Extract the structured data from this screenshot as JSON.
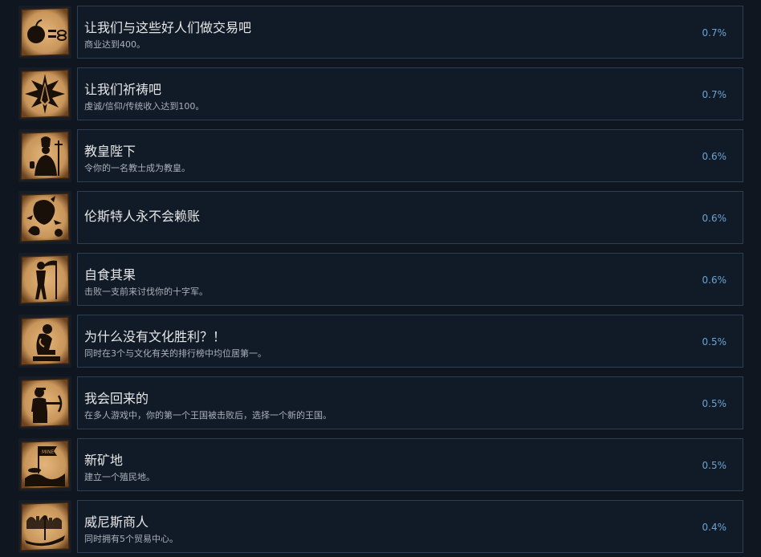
{
  "colors": {
    "background": "#10161f",
    "panel": "#111b27",
    "panel_border": "#2b3e54",
    "title": "#e6e6e6",
    "description": "#a9b1ba",
    "percent": "#6aa3d3",
    "parchment": "#c8955a",
    "silhouette": "#1a100a"
  },
  "achievements": [
    {
      "icon": "apple-coins-icon",
      "title": "让我们与这些好人们做交易吧",
      "description": "商业达到400。",
      "percent": "0.7%"
    },
    {
      "icon": "praying-hands-icon",
      "title": "让我们祈祷吧",
      "description": "虔诚/信仰/传统收入达到100。",
      "percent": "0.7%"
    },
    {
      "icon": "pope-icon",
      "title": "教皇陛下",
      "description": "令你的一名教士成为教皇。",
      "percent": "0.6%"
    },
    {
      "icon": "lion-moneybag-icon",
      "title": "伦斯特人永不会赖账",
      "description": "",
      "percent": "0.6%"
    },
    {
      "icon": "reaper-icon",
      "title": "自食其果",
      "description": "击败一支前来讨伐你的十字军。",
      "percent": "0.6%"
    },
    {
      "icon": "thinker-icon",
      "title": "为什么没有文化胜利？！",
      "description": "同时在3个与文化有关的排行榜中均位居第一。",
      "percent": "0.5%"
    },
    {
      "icon": "crossbowman-icon",
      "title": "我会回来的",
      "description": "在多人游戏中，你的第一个王国被击败后，选择一个新的王国。",
      "percent": "0.5%"
    },
    {
      "icon": "mine-flag-icon",
      "title": "新矿地",
      "description": "建立一个殖民地。",
      "percent": "0.5%"
    },
    {
      "icon": "gondola-icon",
      "title": "威尼斯商人",
      "description": "同时拥有5个贸易中心。",
      "percent": "0.4%"
    }
  ]
}
